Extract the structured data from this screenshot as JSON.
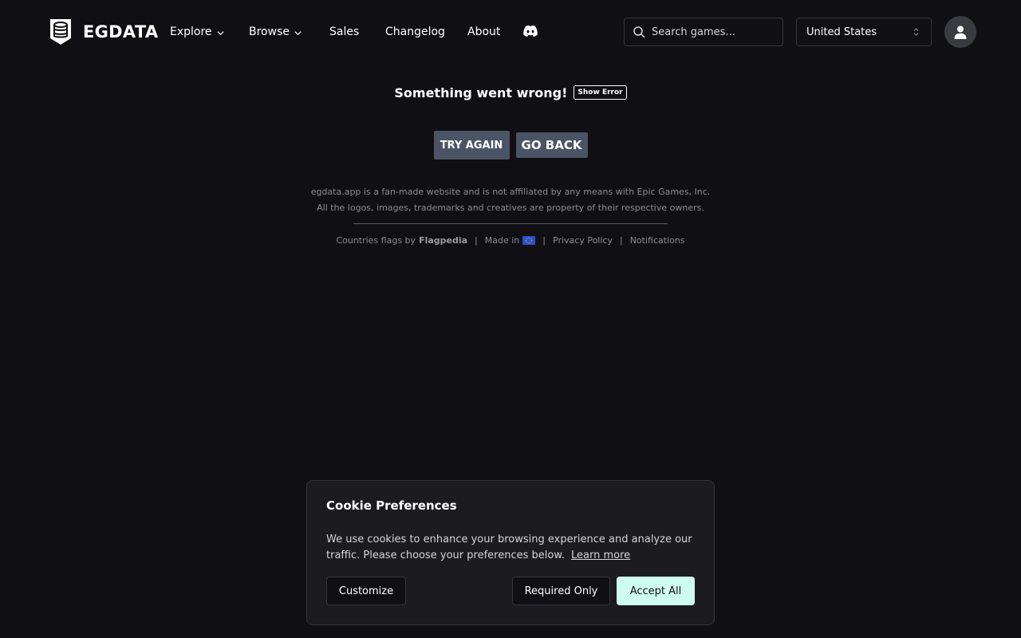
{
  "header": {
    "brand": "EGDATA",
    "nav": [
      {
        "label": "Explore",
        "dropdown": true
      },
      {
        "label": "Browse",
        "dropdown": true
      },
      {
        "label": "Sales",
        "dropdown": false
      },
      {
        "label": "Changelog",
        "dropdown": false
      },
      {
        "label": "About",
        "dropdown": false
      }
    ],
    "discord_icon": "discord-icon",
    "search": {
      "placeholder": "Search games...",
      "value": ""
    },
    "country": {
      "selected": "United States"
    },
    "avatar_icon": "user-icon"
  },
  "error": {
    "title": "Something went wrong!",
    "show_error_label": "Show Error",
    "try_again_label": "TRY AGAIN",
    "go_back_label": "GO BACK"
  },
  "footer": {
    "disclaimer_line1": "egdata.app is a fan-made website and is not affiliated by any means with Epic Games, Inc.",
    "disclaimer_line2": "All the logos, images, trademarks and creatives are property of their respective owners.",
    "flags_prefix": "Countries flags by",
    "flags_link": "Flagpedia",
    "made_in": "Made in",
    "made_in_flag": "eu-flag-icon",
    "privacy_policy": "Privacy Policy",
    "notifications": "Notifications",
    "separator": "|"
  },
  "cookie": {
    "title": "Cookie Preferences",
    "text": "We use cookies to enhance your browsing experience and analyze our traffic. Please choose your preferences below.",
    "learn_more": "Learn more",
    "customize_label": "Customize",
    "required_only_label": "Required Only",
    "accept_all_label": "Accept All"
  },
  "colors": {
    "background": "#101014",
    "accent_button": "#cffcf0",
    "action_button": "#4b5464"
  }
}
